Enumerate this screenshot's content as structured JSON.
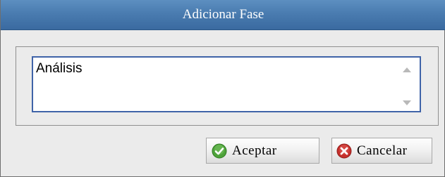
{
  "dialog": {
    "title": "Adicionar Fase",
    "field_value": "Análisis",
    "buttons": {
      "ok_label": "Aceptar",
      "cancel_label": "Cancelar"
    },
    "icons": {
      "ok": "check-icon",
      "cancel": "close-icon"
    },
    "colors": {
      "titlebar": "#4a7cb0",
      "field_border": "#3f63a8",
      "ok_icon": "#4ea23a",
      "cancel_icon": "#c6302c"
    }
  }
}
